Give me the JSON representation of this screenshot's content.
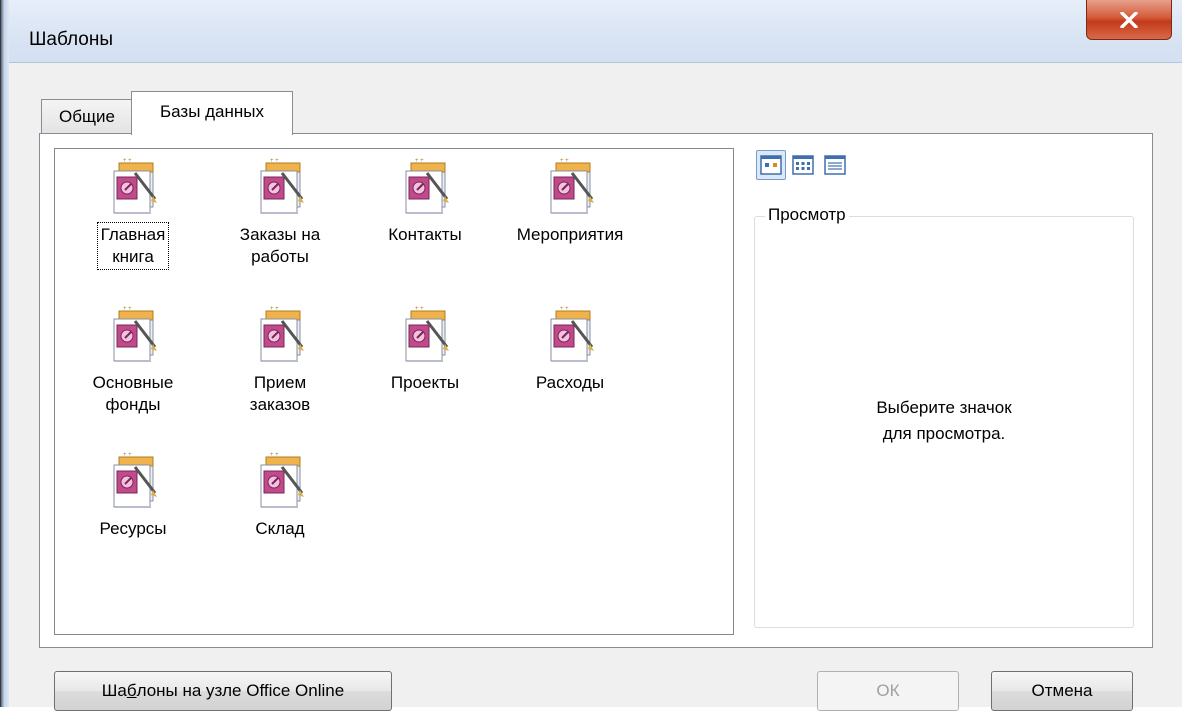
{
  "window": {
    "title": "Шаблоны"
  },
  "tabs": [
    {
      "label": "Общие",
      "active": false
    },
    {
      "label": "Базы данных",
      "active": true
    }
  ],
  "templates": [
    {
      "label": "Главная\nкнига",
      "selected": true
    },
    {
      "label": "Заказы на\nработы",
      "selected": false
    },
    {
      "label": "Контакты",
      "selected": false
    },
    {
      "label": "Мероприятия",
      "selected": false
    },
    {
      "label": "Основные\nфонды",
      "selected": false
    },
    {
      "label": "Прием\nзаказов",
      "selected": false
    },
    {
      "label": "Проекты",
      "selected": false
    },
    {
      "label": "Расходы",
      "selected": false
    },
    {
      "label": "Ресурсы",
      "selected": false
    },
    {
      "label": "Склад",
      "selected": false
    }
  ],
  "view_buttons": [
    {
      "icon": "large-icons-view-icon",
      "active": true
    },
    {
      "icon": "list-view-icon",
      "active": false
    },
    {
      "icon": "details-view-icon",
      "active": false
    }
  ],
  "preview": {
    "legend": "Просмотр",
    "message": "Выберите значок\nдля просмотра."
  },
  "buttons": {
    "online_before": "Ша",
    "online_accel": "б",
    "online_after": "лоны на узле Office Online",
    "ok": "ОК",
    "cancel": "Отмена"
  },
  "colors": {
    "accent": "#c23a1a",
    "window_frame": "#dce7f5"
  }
}
